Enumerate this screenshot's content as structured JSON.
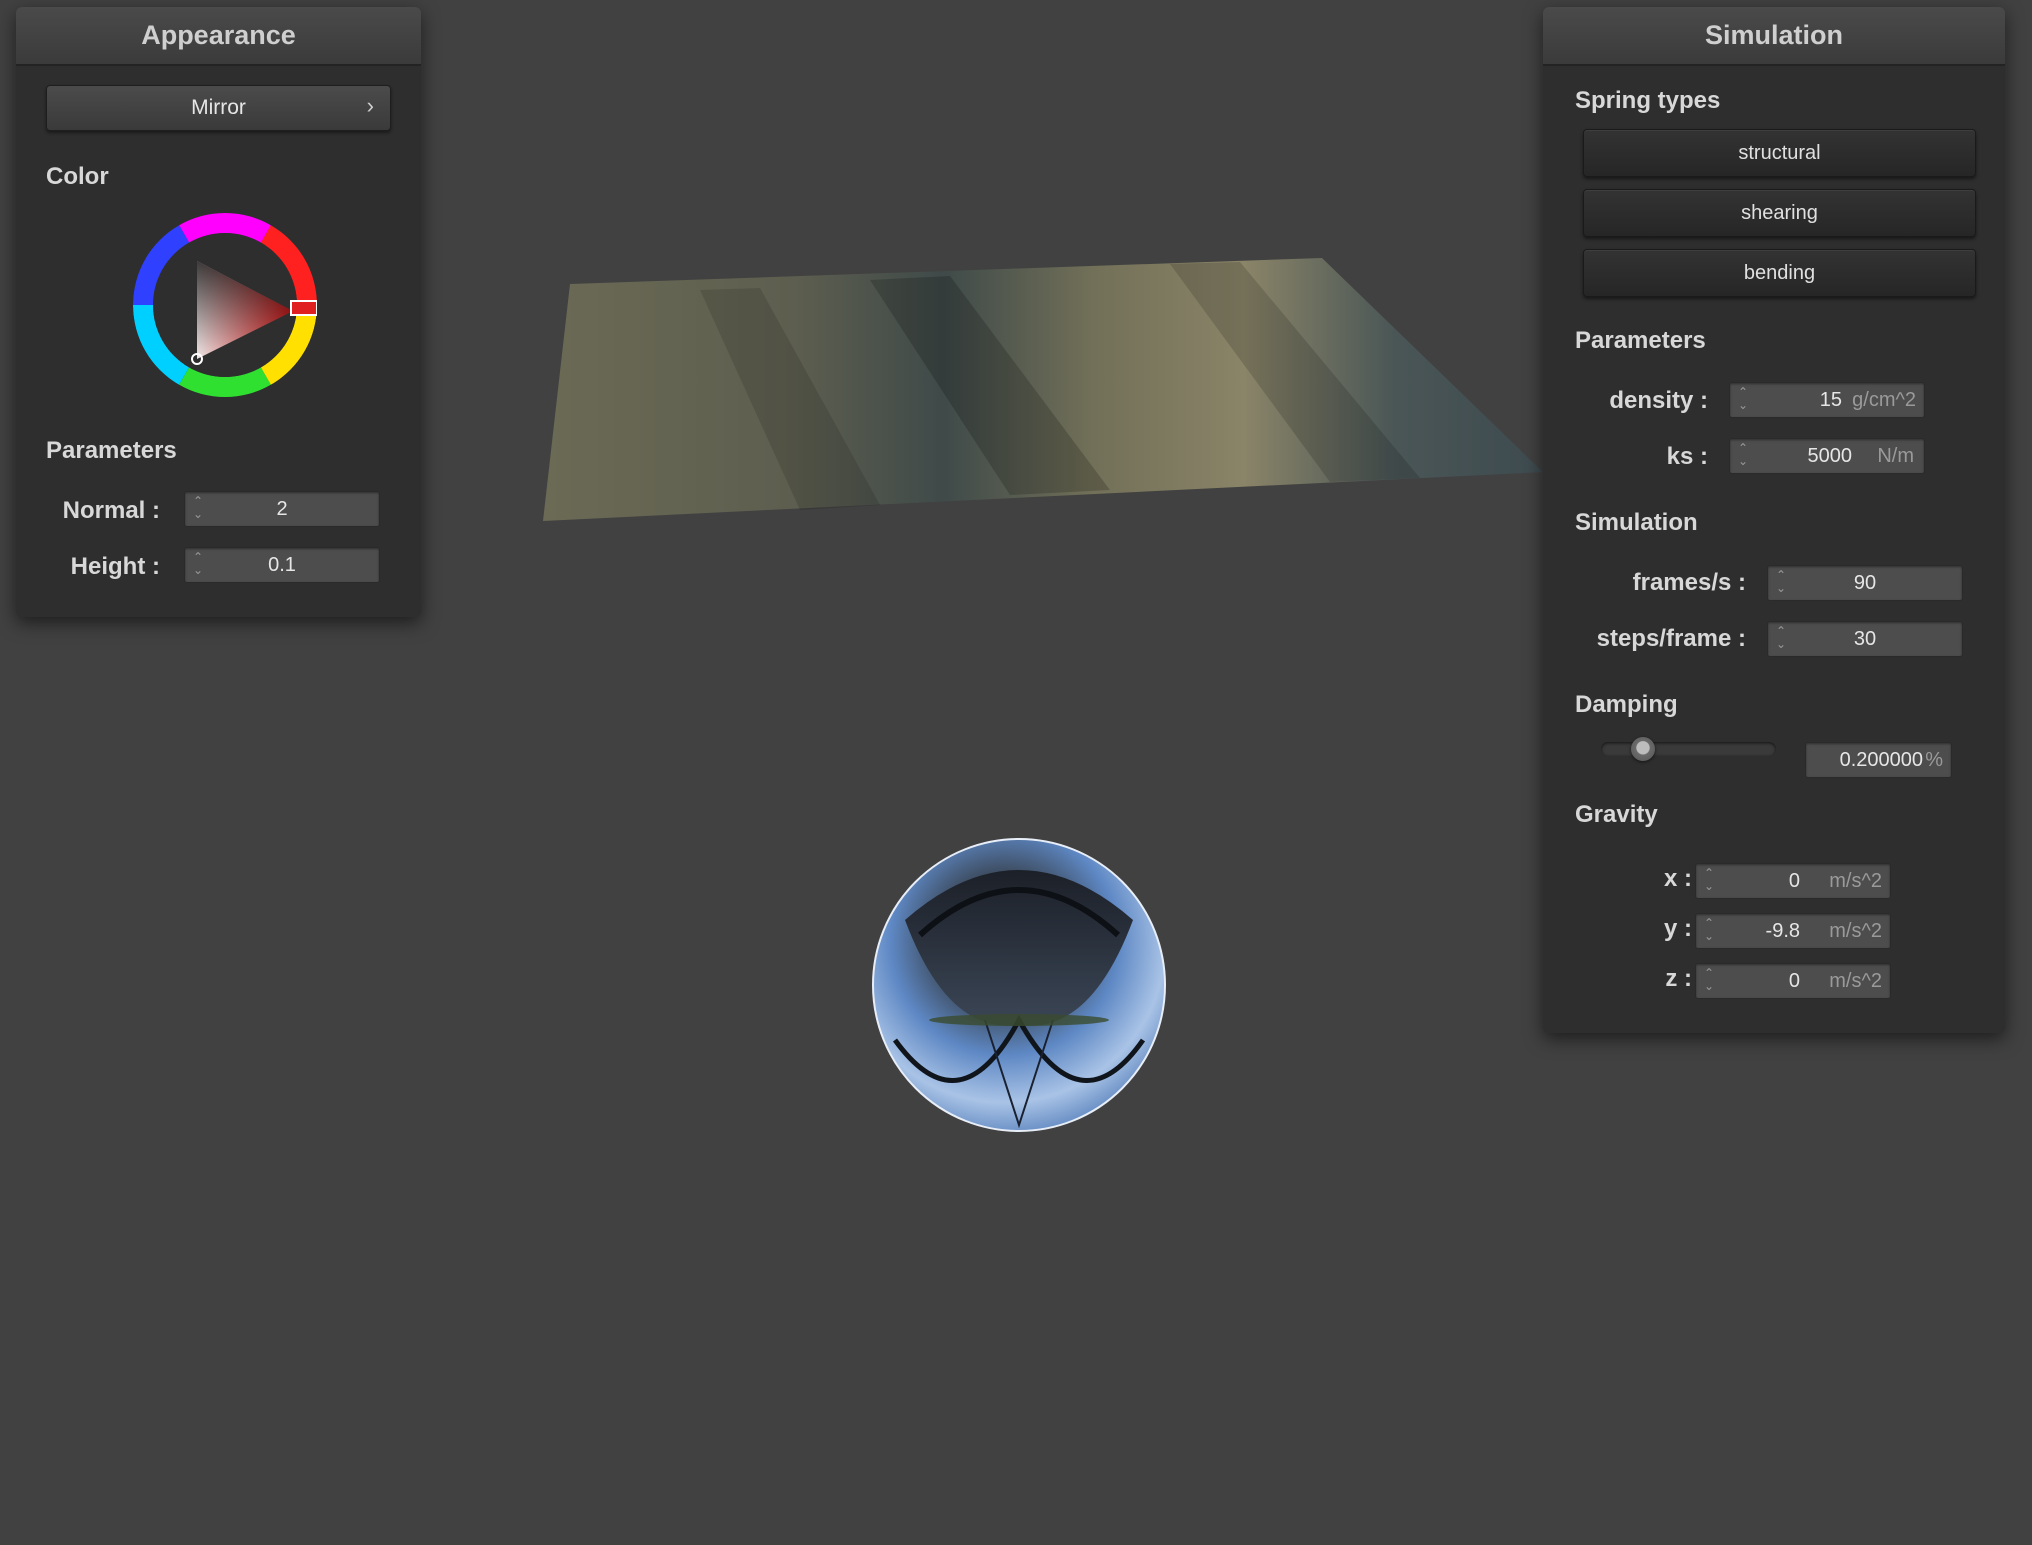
{
  "appearance": {
    "title": "Appearance",
    "shader_select": {
      "value": "Mirror",
      "chevron_icon": "chevron-right-icon"
    },
    "color_label": "Color",
    "color_picker": {
      "selected_color": "#e02020",
      "icon": "color-wheel"
    },
    "parameters_label": "Parameters",
    "params": [
      {
        "label": "Normal :",
        "value": "2"
      },
      {
        "label": "Height :",
        "value": "0.1"
      }
    ]
  },
  "simulation": {
    "title": "Simulation",
    "spring_types_label": "Spring types",
    "spring_buttons": [
      "structural",
      "shearing",
      "bending"
    ],
    "parameters_label": "Parameters",
    "density": {
      "label": "density :",
      "value": "15",
      "unit": "g/cm^2"
    },
    "ks": {
      "label": "ks :",
      "value": "5000",
      "unit": "N/m"
    },
    "simulation_label": "Simulation",
    "frames": {
      "label": "frames/s :",
      "value": "90"
    },
    "steps": {
      "label": "steps/frame :",
      "value": "30"
    },
    "damping_label": "Damping",
    "damping": {
      "value": "0.200000",
      "unit": "%",
      "slider_fraction": 0.2
    },
    "gravity_label": "Gravity",
    "gravity": [
      {
        "label": "x :",
        "value": "0",
        "unit": "m/s^2"
      },
      {
        "label": "y :",
        "value": "-9.8",
        "unit": "m/s^2"
      },
      {
        "label": "z :",
        "value": "0",
        "unit": "m/s^2"
      }
    ]
  },
  "colors": {
    "background": "#414141",
    "panel": "#2e2e2e",
    "field": "#4d4d4d",
    "accent_red": "#e02020",
    "sphere_blue": "#4a78b8"
  }
}
